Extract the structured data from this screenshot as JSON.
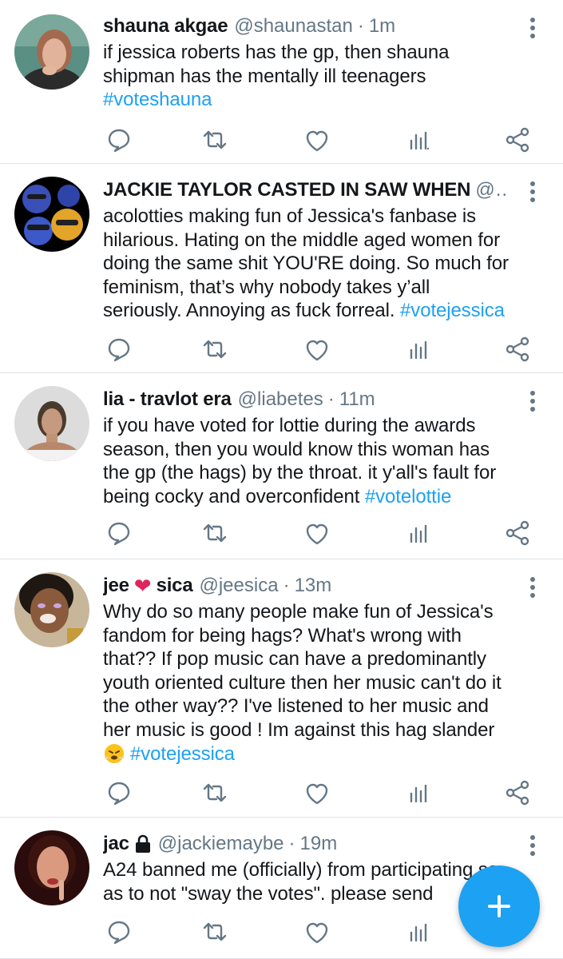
{
  "tweets": [
    {
      "name": "shauna akgae",
      "handle": "@shaunastan",
      "time": "1m",
      "text_lines": [
        "if jessica roberts has the gp, then shauna",
        "shipman has the mentally ill teenagers"
      ],
      "hashtag_line": "#voteshauna"
    },
    {
      "name": "JACKIE TAYLOR CASTED IN SAW WHEN",
      "handle": "@...",
      "text_lines": [
        "acolotties making fun of Jessica's fanbase is",
        "hilarious. Hating on the middle aged women for",
        "doing the same shit YOU'RE doing. So much for",
        "feminism, that’s why nobody takes y’all"
      ],
      "last_line": "seriously. Annoying as fuck forreal. ",
      "hashtag": "#votejessica"
    },
    {
      "name": "lia - travlot era",
      "handle": "@liabetes",
      "time": "11m",
      "text_lines": [
        "if you have voted for lottie during the awards",
        "season, then you would know this woman has",
        "the gp (the hags) by the throat. it y'all's fault for"
      ],
      "last_line": "being cocky and overconfident ",
      "hashtag": "#votelottie"
    },
    {
      "name_part1": "jee",
      "name_part2": "sica",
      "heart": "❤",
      "handle": "@jeesica",
      "time": "13m",
      "text_lines": [
        "Why do so many people make fun of Jessica's",
        "fandom for being hags? What's wrong with",
        "that?? If pop music can have a predominantly",
        "youth oriented culture then her music can't do it",
        "the other way?? I've listened to her music and",
        "her music is good ! Im against this hag slander"
      ],
      "hashtag": "#votejessica"
    },
    {
      "name": "jac",
      "handle": "@jackiemaybe",
      "time": "19m",
      "text_lines": [
        "A24 banned me (officially) from participating so",
        "as to not \"sway the votes\". please send"
      ]
    }
  ],
  "separator": "·",
  "icons": {
    "reply": "reply-icon",
    "retweet": "retweet-icon",
    "like": "heart-icon",
    "stats": "stats-icon",
    "share": "share-icon",
    "more": "more-vertical-icon",
    "compose": "plus-icon",
    "lock": "lock-icon"
  },
  "colors": {
    "link": "#1da1f2",
    "muted": "#657786",
    "text": "#14171a",
    "fab": "#1da1f2",
    "divider": "#dfe3e7"
  }
}
